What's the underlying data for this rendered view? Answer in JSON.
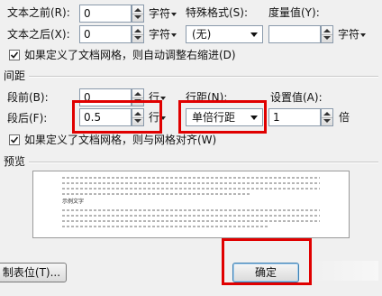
{
  "indent": {
    "before_text_label": "文本之前(R):",
    "before_text_value": "0",
    "after_text_label": "文本之后(X):",
    "after_text_value": "0",
    "unit_char": "字符",
    "special_format_label": "特殊格式(S):",
    "special_format_value": "(无)",
    "measure_label": "度量值(Y):",
    "measure_value": "",
    "auto_indent_checkbox_label": "如果定义了文档网格，则自动调整右缩进(D)"
  },
  "spacing": {
    "section_title": "间距",
    "before_label": "段前(B):",
    "before_value": "0",
    "after_label": "段后(F):",
    "after_value": "0.5",
    "unit_line": "行",
    "line_spacing_label": "行距(N):",
    "line_spacing_value": "单倍行距",
    "set_value_label": "设置值(A):",
    "set_value_value": "1",
    "set_value_unit": "倍",
    "snap_grid_checkbox_label": "如果定义了文档网格，则与网格对齐(W)"
  },
  "preview": {
    "section_title": "预览",
    "sample_text": "示例文字"
  },
  "buttons": {
    "tabs_label": "制表位(T)...",
    "ok_label": "确定"
  },
  "colors": {
    "highlight": "#e00000",
    "dialog_bg": "#f0f0f0"
  }
}
